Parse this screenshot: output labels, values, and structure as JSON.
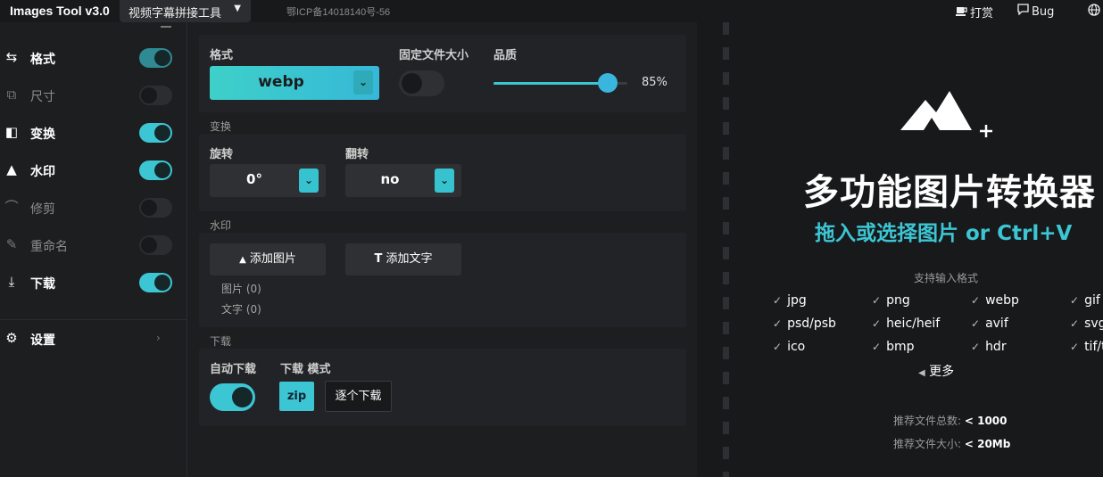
{
  "header": {
    "app_title": "Images Tool v3.0",
    "tool_select_label": "视频字幕拼接工具",
    "icp": "鄂ICP备14018140号-56",
    "donate_label": "打赏",
    "bug_label": "Bug"
  },
  "sidebar": {
    "items": [
      {
        "label": "格式",
        "icon": "swap-icon",
        "enabled": true
      },
      {
        "label": "尺寸",
        "icon": "resize-icon",
        "enabled": false
      },
      {
        "label": "变换",
        "icon": "transform-icon",
        "enabled": true
      },
      {
        "label": "水印",
        "icon": "watermark-icon",
        "enabled": true
      },
      {
        "label": "修剪",
        "icon": "crop-icon",
        "enabled": false
      },
      {
        "label": "重命名",
        "icon": "rename-icon",
        "enabled": false
      },
      {
        "label": "下载",
        "icon": "download-icon",
        "enabled": true
      }
    ],
    "settings_label": "设置"
  },
  "format_section": {
    "format_label": "格式",
    "format_value": "webp",
    "fixed_size_label": "固定文件大小",
    "fixed_size_enabled": false,
    "quality_label": "品质",
    "quality_value": "85%",
    "quality_fraction": 0.85
  },
  "transform_section": {
    "title": "变换",
    "rotate_label": "旋转",
    "rotate_value": "0°",
    "flip_label": "翻转",
    "flip_value": "no"
  },
  "watermark_section": {
    "title": "水印",
    "add_image_label": "添加图片",
    "add_text_label": "添加文字",
    "image_count": "图片 (0)",
    "text_count": "文字 (0)"
  },
  "download_section": {
    "title": "下载",
    "auto_label": "自动下载",
    "auto_enabled": true,
    "mode_label": "下载 模式",
    "zip_label": "zip",
    "one_by_one_label": "逐个下载"
  },
  "dropzone": {
    "headline": "多功能图片转换器",
    "subline": "拖入或选择图片 or Ctrl+V",
    "formats_title": "支持输入格式",
    "formats": [
      "jpg",
      "png",
      "webp",
      "gif",
      "psd/psb",
      "heic/heif",
      "avif",
      "svg",
      "ico",
      "bmp",
      "hdr",
      "tif/tiff"
    ],
    "more_label": "更多",
    "rec_count_label": "推荐文件总数:",
    "rec_count_value": "< 1000",
    "rec_size_label": "推荐文件大小:",
    "rec_size_value": "< 20Mb"
  },
  "colors": {
    "accent": "#3cc6d4",
    "background": "#1b1c1e"
  }
}
